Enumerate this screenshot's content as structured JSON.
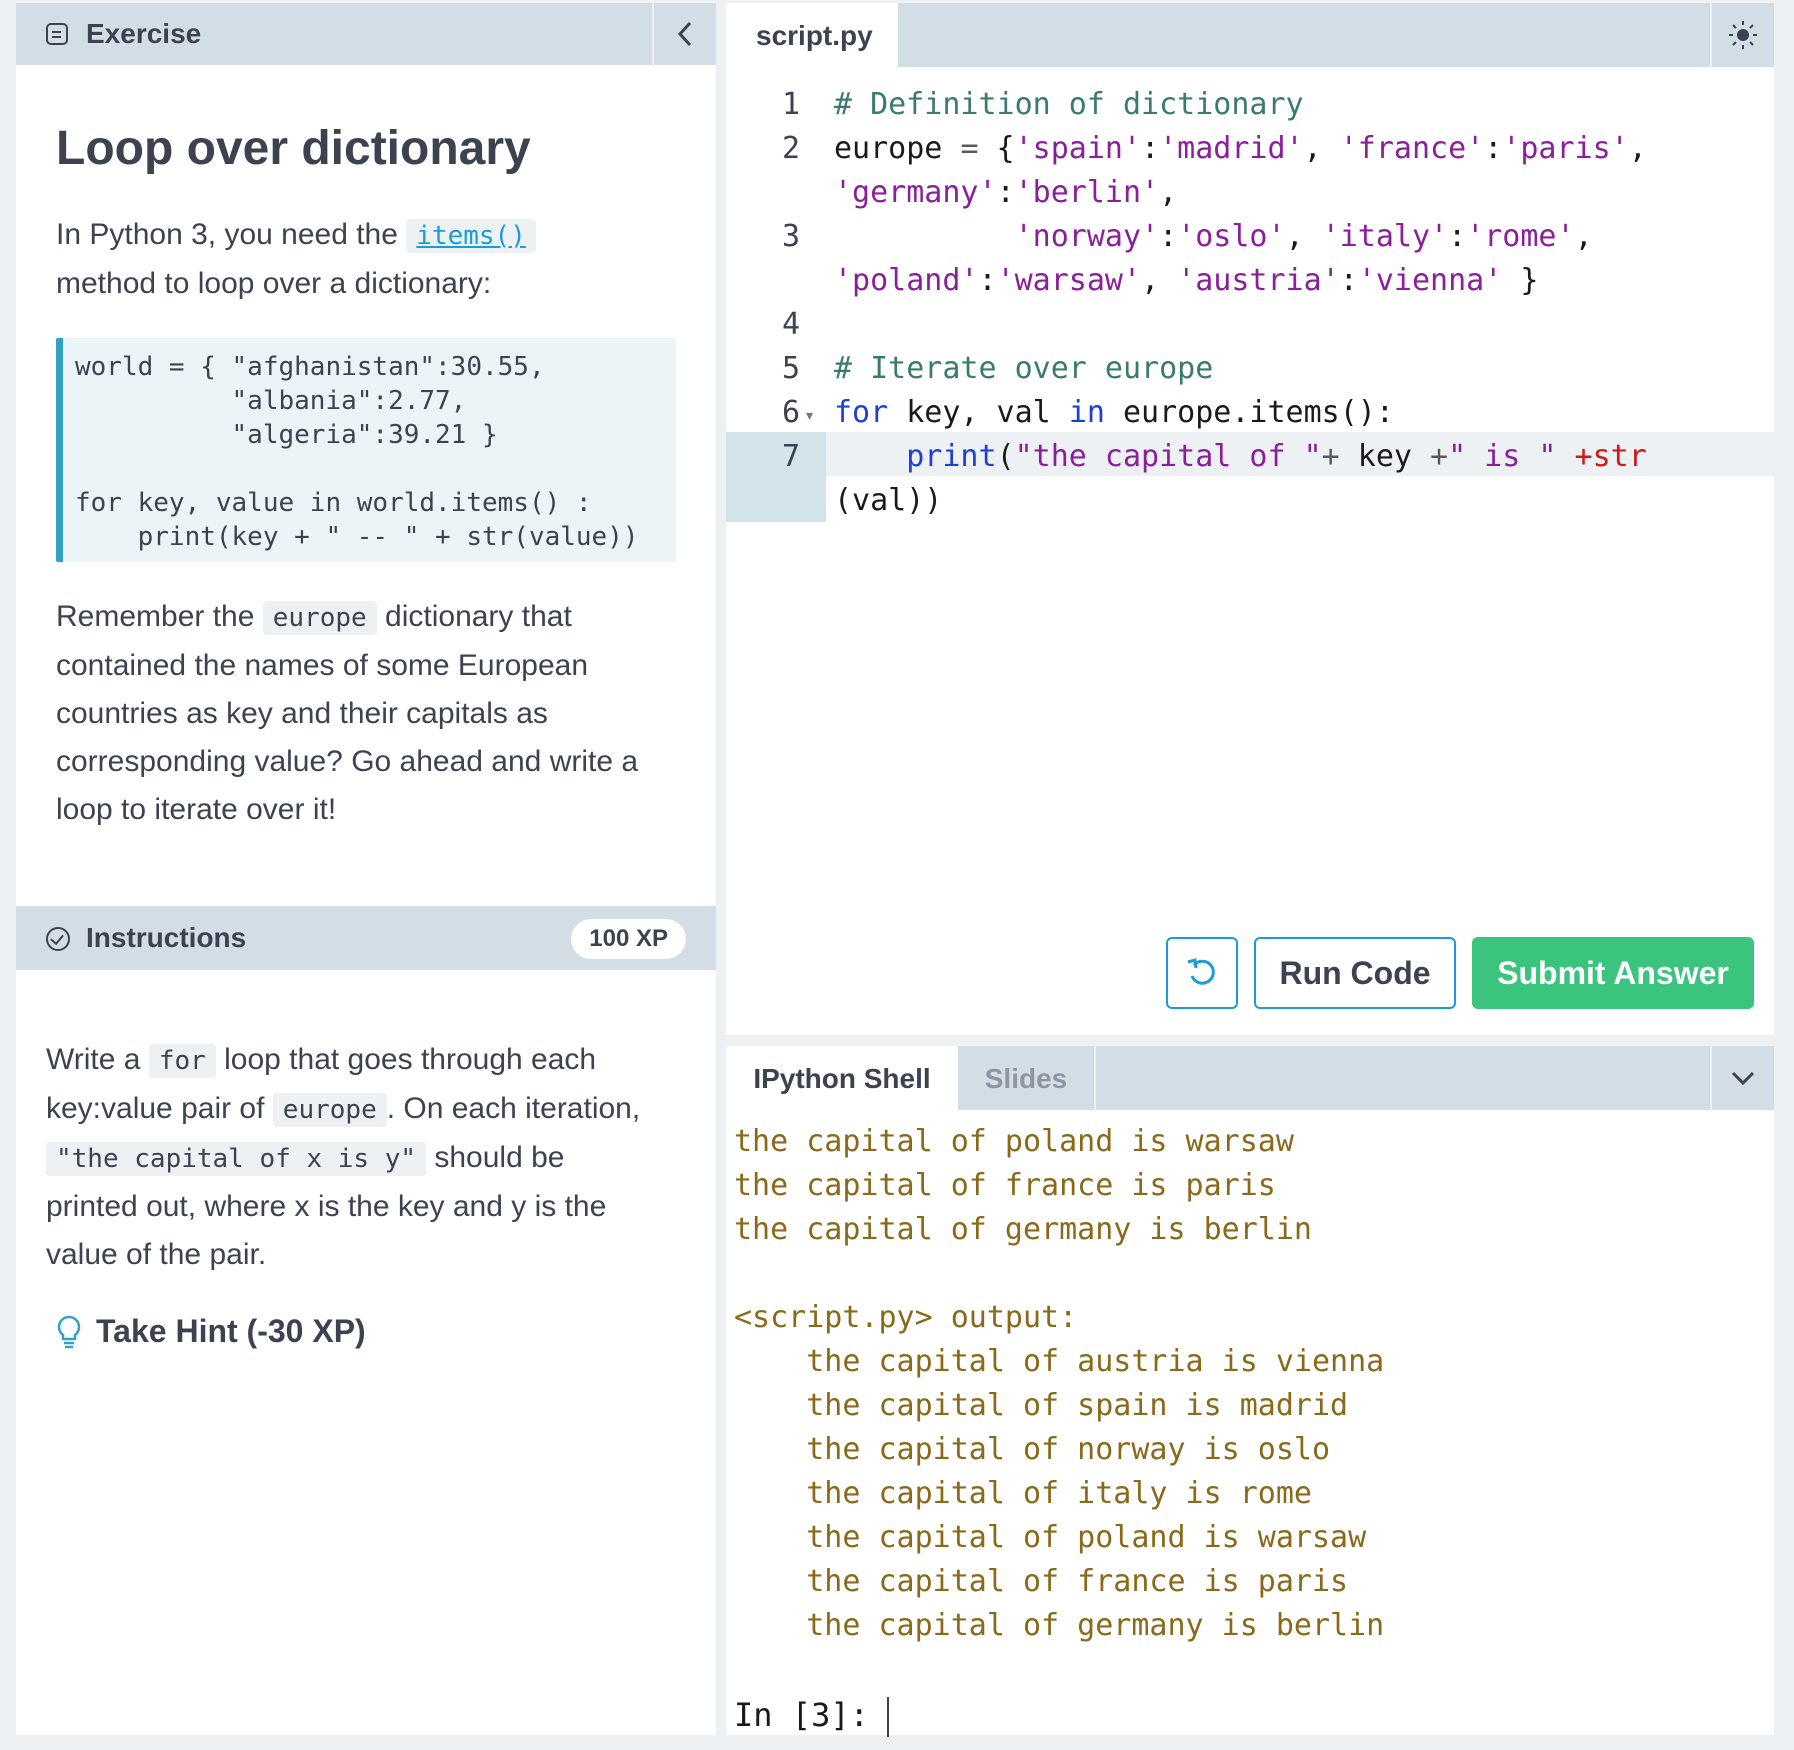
{
  "exercise": {
    "header_label": "Exercise",
    "title": "Loop over dictionary",
    "intro_before": "In Python 3, you need the",
    "intro_code": "items()",
    "intro_after": "method to loop over a dictionary:",
    "code_lines": [
      "world = { \"afghanistan\":30.55,",
      "          \"albania\":2.77,",
      "          \"algeria\":39.21 }",
      "",
      "for key, value in world.items() :",
      "    print(key + \" -- \" + str(value))"
    ],
    "remember_before": "Remember the",
    "remember_code": "europe",
    "remember_line1_after": "dictionary that",
    "remember_line2": "contained the names of some European",
    "remember_line3": "countries as key and their capitals as",
    "remember_line4": "corresponding value? Go ahead and write a",
    "remember_line5": "loop to iterate over it!"
  },
  "instructions": {
    "header_label": "Instructions",
    "xp_badge": "100 XP",
    "write_a": "Write a",
    "for_code": "for",
    "loop_text": "loop that goes through each",
    "keyvalue_text": "key:value pair of",
    "europe_code": "europe",
    "on_each": ". On each iteration,",
    "capital_code": "\"the capital of x is y\"",
    "should_be": "should be",
    "line4": "printed out, where x is the key and y is the",
    "line5": "value of the pair.",
    "hint_label": "Take Hint (-30 XP)"
  },
  "editor": {
    "tab_label": "script.py",
    "line_numbers": [
      "1",
      "2",
      "3",
      "4",
      "5",
      "6",
      "7"
    ],
    "buttons": {
      "run": "Run Code",
      "submit": "Submit Answer"
    }
  },
  "shell": {
    "tabs": [
      "IPython Shell",
      "Slides"
    ],
    "output_lines": [
      "the capital of poland is warsaw",
      "the capital of france is paris",
      "the capital of germany is berlin",
      "",
      "<script.py> output:",
      "    the capital of austria is vienna",
      "    the capital of spain is madrid",
      "    the capital of norway is oslo",
      "    the capital of italy is rome",
      "    the capital of poland is warsaw",
      "    the capital of france is paris",
      "    the capital of germany is berlin"
    ],
    "prompt": "In [3]:"
  },
  "colors": {
    "header_bg": "#d3dde5",
    "accent_blue": "#1b9cd4",
    "submit_green": "#3ac47d",
    "output_text": "#8a6a1a"
  }
}
